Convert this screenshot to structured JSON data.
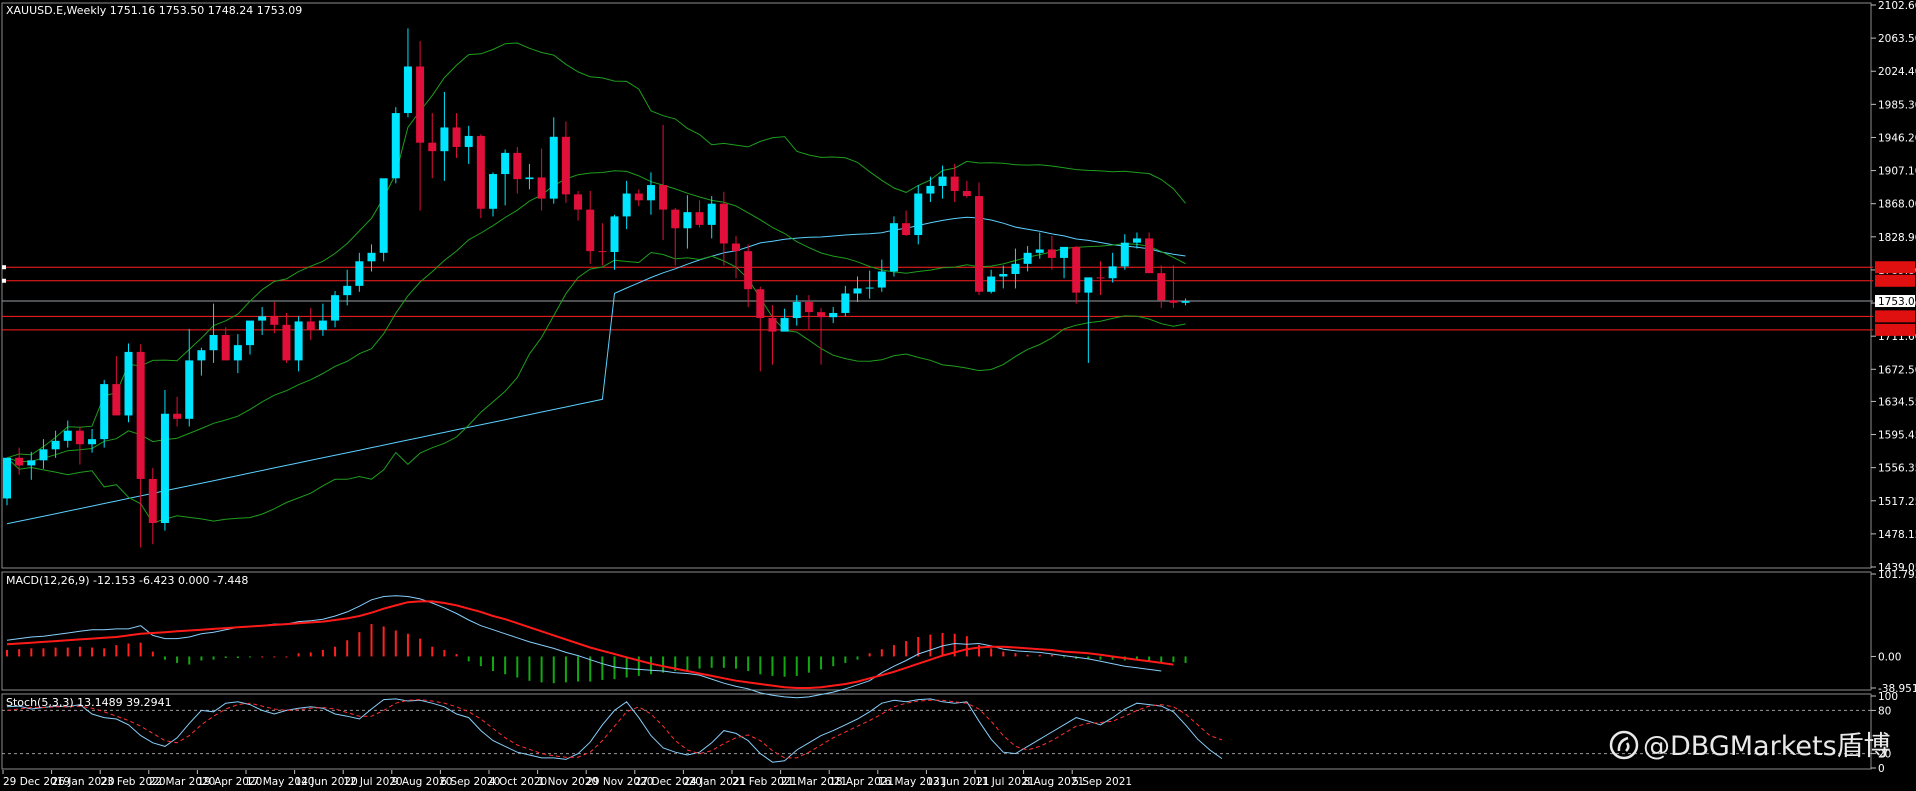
{
  "header": {
    "symbol_line": "XAUUSD.E,Weekly  1751.16 1753.50 1748.24 1753.09",
    "macd_label": "MACD(12,26,9) -12.153 -6.423 0.000 -7.448",
    "stoch_label": "Stoch(5,3,3) 13.1489 39.2941"
  },
  "watermark": {
    "text": "@DBGMarkets盾博",
    "icon": "weibo-logo-icon"
  },
  "colors": {
    "background": "#000000",
    "bull": "#00e5ff",
    "bear": "#e0103a",
    "hline_red": "#ff1f1f",
    "sma_long": "#5ad0ff",
    "bollinger": "#1e9e1e",
    "macd_pos": "#ff2020",
    "macd_neg": "#12a812",
    "macd_signal": "#ff1a1a",
    "macd_line": "#87cefa",
    "stoch_main": "#87cefa",
    "stoch_signal": "#ff3030",
    "price_tag_bg": "#ffffff",
    "level_tag_bg": "#e01010"
  },
  "chart_data": [
    {
      "type": "candlestick",
      "title": "XAUUSD.E,Weekly",
      "ylim": [
        1439.05,
        2102.6
      ],
      "y_ticks": [
        "2102.60",
        "2063.50",
        "2024.40",
        "1985.30",
        "1946.20",
        "1907.10",
        "1868.00",
        "1828.90",
        "1789.80",
        "1750.70",
        "1711.60",
        "1672.50",
        "1634.55",
        "1595.45",
        "1556.35",
        "1517.25",
        "1478.15",
        "1439.05"
      ],
      "x_ticks": [
        "29 Dec 2019",
        "26 Jan 2020",
        "23 Feb 2020",
        "22 Mar 2020",
        "19 Apr 2020",
        "17 May 2020",
        "14 Jun 2020",
        "12 Jul 2020",
        "9 Aug 2020",
        "6 Sep 2020",
        "4 Oct 2020",
        "1 Nov 2020",
        "29 Nov 2020",
        "27 Dec 2020",
        "24 Jan 2021",
        "21 Feb 2021",
        "21 Mar 2021",
        "18 Apr 2021",
        "16 May 2021",
        "13 Jun 2021",
        "11 Jul 2021",
        "8 Aug 2021",
        "5 Sep 2021"
      ],
      "last_price": 1753.09,
      "last_price_label": "1753.09",
      "horizontal_levels": [
        1793,
        1777,
        1735,
        1719
      ],
      "ohlc": [
        [
          1520,
          1545,
          1512,
          1568
        ],
        [
          1568,
          1580,
          1548,
          1559
        ],
        [
          1559,
          1575,
          1542,
          1565
        ],
        [
          1565,
          1590,
          1555,
          1578
        ],
        [
          1578,
          1600,
          1568,
          1588
        ],
        [
          1588,
          1612,
          1580,
          1600
        ],
        [
          1600,
          1605,
          1560,
          1584
        ],
        [
          1584,
          1602,
          1574,
          1590
        ],
        [
          1590,
          1660,
          1580,
          1655
        ],
        [
          1655,
          1688,
          1630,
          1618
        ],
        [
          1618,
          1703,
          1610,
          1693
        ],
        [
          1693,
          1702,
          1462,
          1543
        ],
        [
          1543,
          1556,
          1466,
          1491
        ],
        [
          1491,
          1648,
          1482,
          1620
        ],
        [
          1620,
          1640,
          1605,
          1614
        ],
        [
          1614,
          1720,
          1605,
          1683
        ],
        [
          1683,
          1698,
          1665,
          1695
        ],
        [
          1695,
          1750,
          1680,
          1713
        ],
        [
          1713,
          1722,
          1686,
          1683
        ],
        [
          1683,
          1714,
          1668,
          1701
        ],
        [
          1701,
          1725,
          1690,
          1730
        ],
        [
          1730,
          1746,
          1713,
          1735
        ],
        [
          1735,
          1752,
          1715,
          1725
        ],
        [
          1725,
          1739,
          1680,
          1683
        ],
        [
          1683,
          1735,
          1670,
          1729
        ],
        [
          1729,
          1745,
          1707,
          1719
        ],
        [
          1719,
          1750,
          1712,
          1730
        ],
        [
          1730,
          1765,
          1722,
          1760
        ],
        [
          1760,
          1790,
          1748,
          1771
        ],
        [
          1771,
          1810,
          1764,
          1800
        ],
        [
          1800,
          1820,
          1788,
          1810
        ],
        [
          1810,
          1865,
          1800,
          1898
        ],
        [
          1898,
          1982,
          1892,
          1975
        ],
        [
          1975,
          2075,
          1970,
          2030
        ],
        [
          2030,
          2060,
          1860,
          1940
        ],
        [
          1940,
          1975,
          1898,
          1930
        ],
        [
          1930,
          2000,
          1895,
          1958
        ],
        [
          1958,
          1975,
          1922,
          1935
        ],
        [
          1935,
          1960,
          1915,
          1948
        ],
        [
          1948,
          1950,
          1851,
          1862
        ],
        [
          1862,
          1905,
          1853,
          1903
        ],
        [
          1903,
          1932,
          1866,
          1928
        ],
        [
          1928,
          1935,
          1880,
          1897
        ],
        [
          1897,
          1915,
          1885,
          1899
        ],
        [
          1899,
          1933,
          1860,
          1874
        ],
        [
          1874,
          1970,
          1868,
          1947
        ],
        [
          1947,
          1965,
          1869,
          1879
        ],
        [
          1879,
          1883,
          1848,
          1861
        ],
        [
          1861,
          1883,
          1797,
          1812
        ],
        [
          1812,
          1845,
          1795,
          1811
        ],
        [
          1811,
          1855,
          1790,
          1853
        ],
        [
          1853,
          1895,
          1838,
          1880
        ],
        [
          1880,
          1885,
          1865,
          1872
        ],
        [
          1872,
          1905,
          1855,
          1890
        ],
        [
          1890,
          1961,
          1825,
          1861
        ],
        [
          1861,
          1863,
          1795,
          1839
        ],
        [
          1839,
          1878,
          1815,
          1858
        ],
        [
          1858,
          1872,
          1840,
          1843
        ],
        [
          1843,
          1877,
          1827,
          1868
        ],
        [
          1868,
          1882,
          1795,
          1821
        ],
        [
          1821,
          1830,
          1780,
          1812
        ],
        [
          1812,
          1820,
          1746,
          1767
        ],
        [
          1767,
          1770,
          1670,
          1733
        ],
        [
          1733,
          1748,
          1678,
          1717
        ],
        [
          1717,
          1744,
          1718,
          1733
        ],
        [
          1733,
          1760,
          1724,
          1752
        ],
        [
          1752,
          1760,
          1720,
          1740
        ],
        [
          1740,
          1745,
          1678,
          1734
        ],
        [
          1734,
          1746,
          1727,
          1739
        ],
        [
          1739,
          1771,
          1735,
          1762
        ],
        [
          1762,
          1782,
          1752,
          1768
        ],
        [
          1768,
          1789,
          1756,
          1769
        ],
        [
          1769,
          1802,
          1764,
          1788
        ],
        [
          1788,
          1853,
          1782,
          1845
        ],
        [
          1845,
          1860,
          1830,
          1831
        ],
        [
          1831,
          1890,
          1820,
          1880
        ],
        [
          1880,
          1900,
          1870,
          1889
        ],
        [
          1889,
          1913,
          1874,
          1900
        ],
        [
          1900,
          1915,
          1870,
          1883
        ],
        [
          1883,
          1895,
          1875,
          1877
        ],
        [
          1877,
          1893,
          1760,
          1764
        ],
        [
          1764,
          1790,
          1762,
          1782
        ],
        [
          1782,
          1795,
          1768,
          1785
        ],
        [
          1785,
          1815,
          1768,
          1797
        ],
        [
          1797,
          1818,
          1788,
          1810
        ],
        [
          1810,
          1834,
          1803,
          1814
        ],
        [
          1814,
          1830,
          1790,
          1804
        ],
        [
          1804,
          1815,
          1780,
          1817
        ],
        [
          1817,
          1818,
          1750,
          1763
        ],
        [
          1763,
          1780,
          1680,
          1781
        ],
        [
          1781,
          1800,
          1760,
          1780
        ],
        [
          1780,
          1810,
          1775,
          1794
        ],
        [
          1794,
          1832,
          1790,
          1822
        ],
        [
          1822,
          1834,
          1815,
          1827
        ],
        [
          1827,
          1834,
          1790,
          1786
        ],
        [
          1786,
          1795,
          1745,
          1754
        ],
        [
          1754,
          1795,
          1745,
          1751
        ],
        [
          1751,
          1756,
          1748,
          1753
        ]
      ]
    },
    {
      "type": "line",
      "title": "MACD(12,26,9)",
      "ylim": [
        -38.951,
        101.793
      ],
      "y_ticks": [
        "101.793",
        "0.00",
        "-38.951"
      ],
      "histogram": [
        8,
        9,
        10,
        10,
        11,
        11,
        12,
        11,
        10,
        14,
        16,
        17,
        6,
        -4,
        -8,
        -10,
        -5,
        -4,
        -2,
        -2,
        -1,
        0,
        0,
        0,
        4,
        5,
        8,
        12,
        20,
        30,
        40,
        37,
        32,
        28,
        22,
        12,
        8,
        3,
        -6,
        -12,
        -18,
        -22,
        -26,
        -30,
        -32,
        -33,
        -32,
        -31,
        -31,
        -29,
        -28,
        -26,
        -24,
        -22,
        -20,
        -18,
        -17,
        -15,
        -14,
        -14,
        -15,
        -18,
        -22,
        -24,
        -25,
        -24,
        -20,
        -16,
        -12,
        -8,
        -4,
        4,
        9,
        14,
        19,
        24,
        27,
        29,
        28,
        25,
        14,
        10,
        6,
        4,
        2,
        2,
        2,
        -1,
        -3,
        -3,
        -4,
        -4,
        -5,
        -5,
        -6,
        -7,
        -7,
        -8
      ],
      "signal": [
        15,
        16,
        17,
        18,
        19,
        20,
        21,
        22,
        23,
        24,
        26,
        28,
        29,
        30,
        31,
        32,
        33,
        34,
        35,
        36,
        37,
        38,
        39,
        40,
        41,
        42,
        43,
        45,
        47,
        50,
        54,
        59,
        63,
        67,
        68,
        68,
        66,
        63,
        59,
        55,
        50,
        46,
        41,
        36,
        31,
        26,
        21,
        16,
        11,
        7,
        3,
        -1,
        -5,
        -9,
        -12,
        -15,
        -18,
        -21,
        -24,
        -27,
        -30,
        -32,
        -34,
        -36,
        -38,
        -39,
        -39,
        -38,
        -36,
        -34,
        -31,
        -27,
        -23,
        -19,
        -14,
        -9,
        -4,
        1,
        5,
        9,
        11,
        12,
        12,
        11,
        10,
        9,
        8,
        6,
        5,
        4,
        2,
        0,
        -2,
        -4,
        -6,
        -8,
        -10
      ],
      "macd": [
        20,
        22,
        24,
        25,
        27,
        29,
        31,
        33,
        33,
        34,
        34,
        38,
        26,
        22,
        22,
        24,
        28,
        30,
        33,
        36,
        37,
        38,
        40,
        40,
        43,
        44,
        46,
        50,
        55,
        62,
        70,
        74,
        75,
        74,
        71,
        66,
        60,
        53,
        45,
        38,
        33,
        28,
        23,
        18,
        14,
        10,
        5,
        1,
        -4,
        -9,
        -13,
        -15,
        -16,
        -17,
        -18,
        -20,
        -21,
        -23,
        -28,
        -33,
        -37,
        -40,
        -45,
        -48,
        -50,
        -51,
        -50,
        -47,
        -44,
        -40,
        -35,
        -30,
        -20,
        -12,
        -5,
        3,
        8,
        13,
        16,
        15,
        16,
        13,
        9,
        7,
        6,
        5,
        3,
        1,
        -1,
        -3,
        -6,
        -9,
        -12,
        -14,
        -16,
        -18
      ]
    },
    {
      "type": "line",
      "title": "Stoch(5,3,3)",
      "ylim": [
        0,
        100
      ],
      "y_ticks": [
        "100",
        "80",
        "20",
        "0"
      ],
      "levels": [
        80,
        20
      ],
      "main": [
        85,
        86,
        82,
        84,
        86,
        85,
        88,
        75,
        70,
        68,
        60,
        45,
        35,
        30,
        42,
        62,
        80,
        78,
        90,
        92,
        88,
        80,
        75,
        80,
        83,
        85,
        83,
        75,
        72,
        68,
        82,
        95,
        96,
        93,
        94,
        90,
        85,
        75,
        70,
        52,
        38,
        30,
        22,
        18,
        14,
        14,
        12,
        20,
        36,
        60,
        80,
        92,
        70,
        45,
        28,
        22,
        18,
        22,
        35,
        52,
        48,
        38,
        20,
        8,
        10,
        25,
        35,
        45,
        52,
        60,
        68,
        78,
        90,
        94,
        92,
        95,
        96,
        92,
        90,
        92,
        65,
        40,
        22,
        20,
        30,
        40,
        50,
        60,
        70,
        65,
        60,
        70,
        82,
        90,
        88,
        86,
        78,
        60,
        40,
        25,
        13
      ],
      "signal": [
        80,
        82,
        84,
        84,
        85,
        85,
        86,
        83,
        78,
        72,
        66,
        58,
        48,
        38,
        35,
        45,
        60,
        72,
        82,
        88,
        90,
        86,
        82,
        80,
        81,
        83,
        84,
        82,
        77,
        72,
        72,
        80,
        90,
        94,
        95,
        93,
        90,
        85,
        78,
        68,
        55,
        42,
        32,
        26,
        20,
        17,
        15,
        15,
        22,
        38,
        58,
        78,
        85,
        75,
        58,
        38,
        25,
        20,
        24,
        34,
        42,
        46,
        38,
        24,
        14,
        14,
        22,
        32,
        42,
        50,
        58,
        66,
        75,
        85,
        90,
        93,
        94,
        94,
        92,
        90,
        82,
        65,
        45,
        30,
        25,
        30,
        38,
        48,
        58,
        62,
        63,
        65,
        72,
        80,
        86,
        88,
        85,
        75,
        60,
        45,
        39
      ]
    }
  ]
}
